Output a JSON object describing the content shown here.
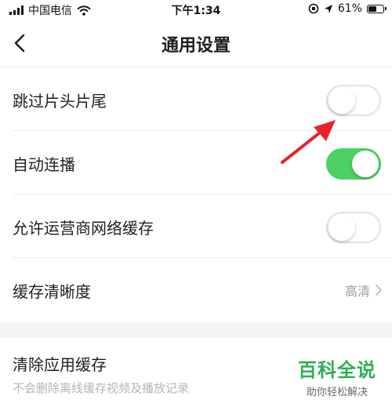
{
  "status_bar": {
    "carrier": "中国电信",
    "time": "下午1:34",
    "battery": "61%",
    "battery_level": 0.61,
    "icons": [
      "signal-icon",
      "wifi-icon",
      "orientation-lock-icon",
      "location-icon",
      "battery-icon"
    ]
  },
  "nav": {
    "title": "通用设置",
    "back_icon": "chevron-left-icon"
  },
  "settings": [
    {
      "label": "跳过片头片尾",
      "type": "toggle",
      "enabled": false
    },
    {
      "label": "自动连播",
      "type": "toggle",
      "enabled": true
    },
    {
      "label": "允许运营商网络缓存",
      "type": "toggle",
      "enabled": false
    },
    {
      "label": "缓存清晰度",
      "type": "value",
      "value": "高清"
    }
  ],
  "clear_cache": {
    "title": "清除应用缓存",
    "subtitle": "不会删除离线缓存视频及播放记录"
  },
  "watermark": {
    "title": "百科全说",
    "subtitle": "助你轻松解决"
  },
  "colors": {
    "toggle_on": "#4cd164",
    "toggle_off_border": "#e3e3e3",
    "annotation_arrow": "#e8242b",
    "watermark_green": "#2fae55"
  }
}
